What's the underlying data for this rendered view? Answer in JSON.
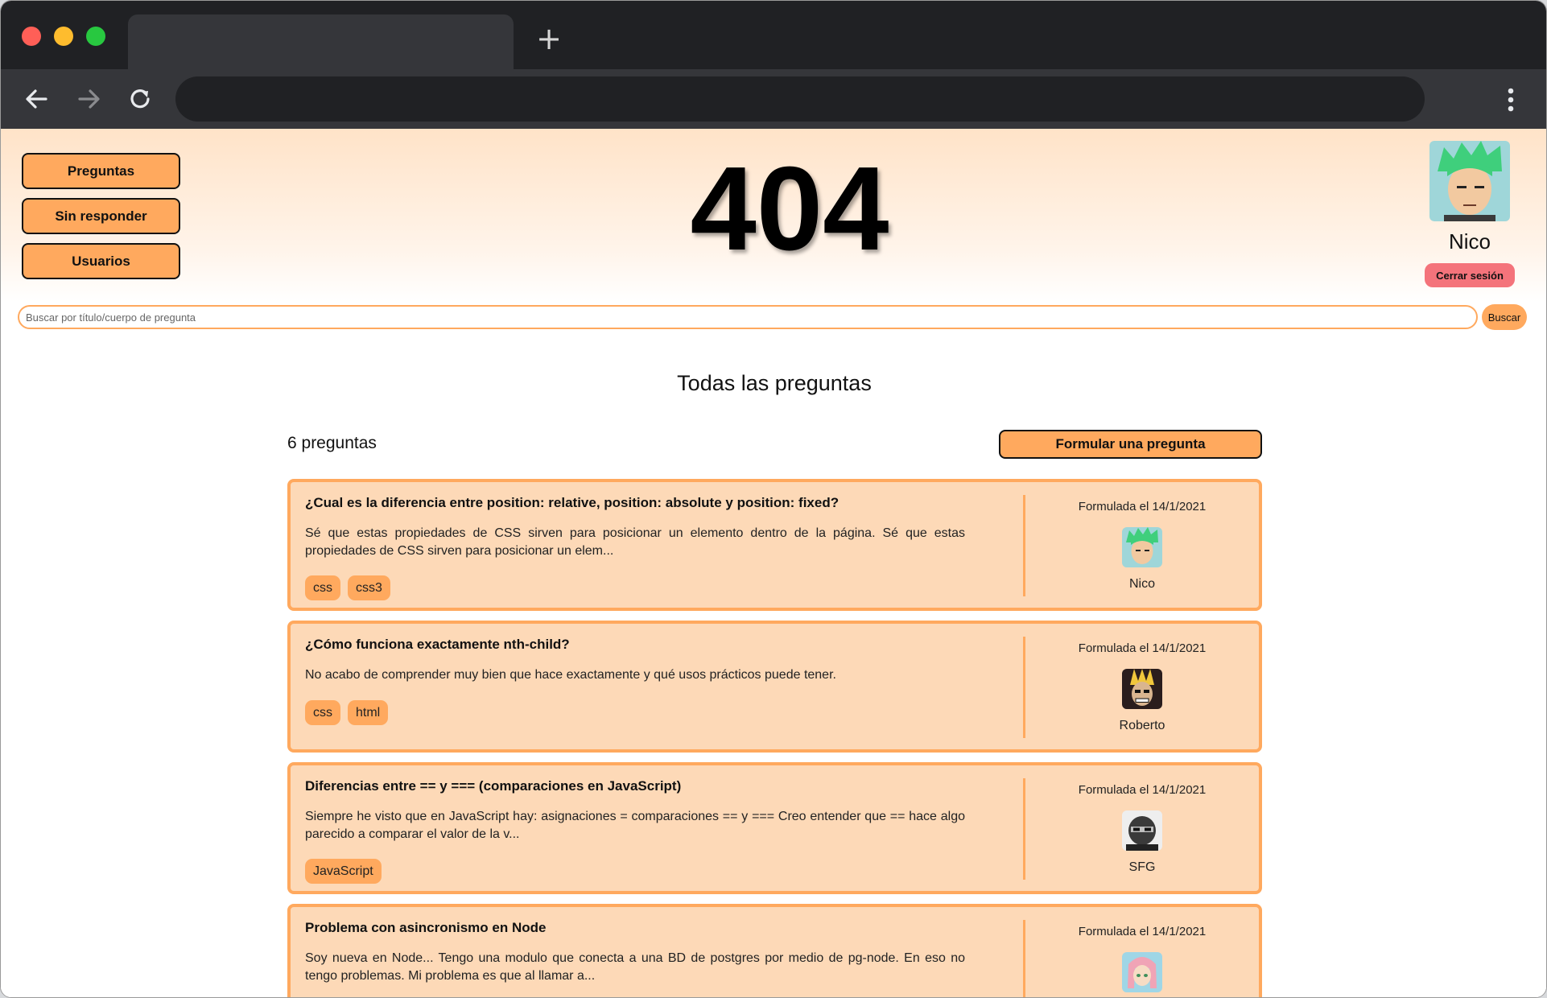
{
  "browser": {
    "new_tab_glyph": "+",
    "icons": [
      "back-arrow-icon",
      "forward-arrow-icon",
      "reload-icon",
      "kebab-menu-icon"
    ]
  },
  "nav": {
    "questions": "Preguntas",
    "unanswered": "Sin responder",
    "users": "Usuarios"
  },
  "error_code": "404",
  "user": {
    "name": "Nico",
    "logout_label": "Cerrar sesión"
  },
  "search": {
    "placeholder": "Buscar por título/cuerpo de pregunta",
    "button_label": "Buscar"
  },
  "main": {
    "title": "Todas las preguntas",
    "count_label": "6 preguntas",
    "ask_label": "Formular una pregunta"
  },
  "colors": {
    "accent": "#ffa95e",
    "card_bg": "#fdd9b7",
    "logout": "#f4737b"
  },
  "questions": [
    {
      "title": "¿Cual es la diferencia entre position: relative, position: absolute y position: fixed?",
      "body": "Sé que estas propiedades de CSS sirven para posicionar un elemento dentro de la página. Sé que estas propiedades de CSS sirven para posicionar un elem...",
      "tags": [
        "css",
        "css3"
      ],
      "asked": "Formulada el 14/1/2021",
      "author": "Nico",
      "avatar": "green-hair-avatar"
    },
    {
      "title": "¿Cómo funciona exactamente nth-child?",
      "body": "No acabo de comprender muy bien que hace exactamente y qué usos prácticos puede tener.",
      "tags": [
        "css",
        "html"
      ],
      "asked": "Formulada el 14/1/2021",
      "author": "Roberto",
      "avatar": "blond-hero-avatar"
    },
    {
      "title": "Diferencias entre == y === (comparaciones en JavaScript)",
      "body": "Siempre he visto que en JavaScript hay: asignaciones = comparaciones == y === Creo entender que == hace algo parecido a comparar el valor de la v...",
      "tags": [
        "JavaScript"
      ],
      "asked": "Formulada el 14/1/2021",
      "author": "SFG",
      "avatar": "masked-avatar"
    },
    {
      "title": "Problema con asincronismo en Node",
      "body": "Soy nueva en Node... Tengo una modulo que conecta a una BD de postgres por medio de pg-node. En eso no tengo problemas. Mi problema es que al llamar a...",
      "tags": [],
      "asked": "Formulada el 14/1/2021",
      "author": "",
      "avatar": "pink-hair-avatar"
    }
  ]
}
